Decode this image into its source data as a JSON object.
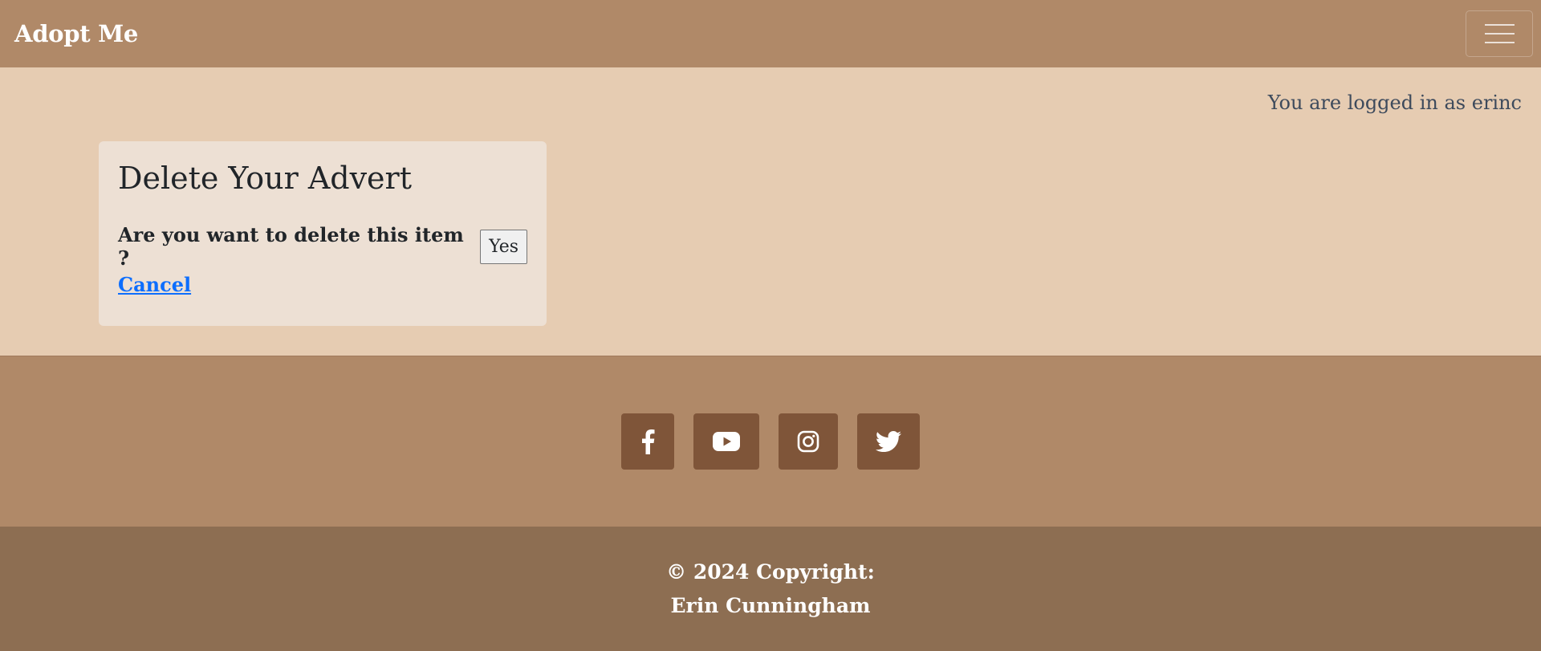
{
  "navbar": {
    "brand": "Adopt Me",
    "toggle_icon": "hamburger-menu-icon"
  },
  "main": {
    "login_status": "You are logged in as erinc",
    "card": {
      "title": "Delete Your Advert",
      "question": "Are you want to delete this item ?",
      "yes_label": "Yes",
      "cancel_label": "Cancel"
    }
  },
  "social": {
    "icons": [
      "facebook-icon",
      "youtube-icon",
      "instagram-icon",
      "twitter-icon"
    ]
  },
  "footer": {
    "copyright": "© 2024 Copyright:",
    "author": "Erin Cunningham"
  },
  "colors": {
    "navbar_bg": "#b08968",
    "page_bg": "#e6ccb2",
    "card_bg": "#ede0d4",
    "social_button_bg": "#7f5539",
    "footer_bg": "#8d6e52",
    "link": "#0d6efd"
  }
}
